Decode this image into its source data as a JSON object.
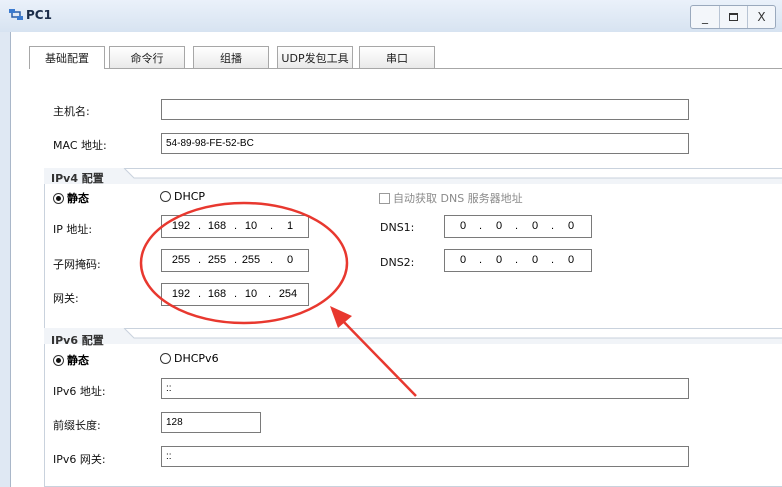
{
  "window": {
    "title": "PC1",
    "controls": {
      "minimize": "_",
      "close": "X"
    }
  },
  "tabs": [
    {
      "label": "基础配置",
      "active": true
    },
    {
      "label": "命令行",
      "active": false
    },
    {
      "label": "组播",
      "active": false
    },
    {
      "label": "UDP发包工具",
      "active": false
    },
    {
      "label": "串口",
      "active": false
    }
  ],
  "basic": {
    "hostname_label": "主机名:",
    "hostname_value": "",
    "mac_label": "MAC 地址:",
    "mac_value": "54-89-98-FE-52-BC"
  },
  "ipv4": {
    "title": "IPv4 配置",
    "static_label": "静态",
    "dhcp_label": "DHCP",
    "mode": "static",
    "auto_dns_label": "自动获取 DNS 服务器地址",
    "auto_dns_checked": false,
    "ip_label": "IP 地址:",
    "ip": [
      "192",
      "168",
      "10",
      "1"
    ],
    "mask_label": "子网掩码:",
    "mask": [
      "255",
      "255",
      "255",
      "0"
    ],
    "gateway_label": "网关:",
    "gateway": [
      "192",
      "168",
      "10",
      "254"
    ],
    "dns1_label": "DNS1:",
    "dns1": [
      "0",
      "0",
      "0",
      "0"
    ],
    "dns2_label": "DNS2:",
    "dns2": [
      "0",
      "0",
      "0",
      "0"
    ]
  },
  "ipv6": {
    "title": "IPv6 配置",
    "static_label": "静态",
    "dhcp_label": "DHCPv6",
    "mode": "static",
    "address_label": "IPv6 地址:",
    "address_value": "::",
    "prefix_label": "前缀长度:",
    "prefix_value": "128",
    "gateway_label": "IPv6 网关:",
    "gateway_value": "::"
  },
  "annotation_color": "#e8382f"
}
